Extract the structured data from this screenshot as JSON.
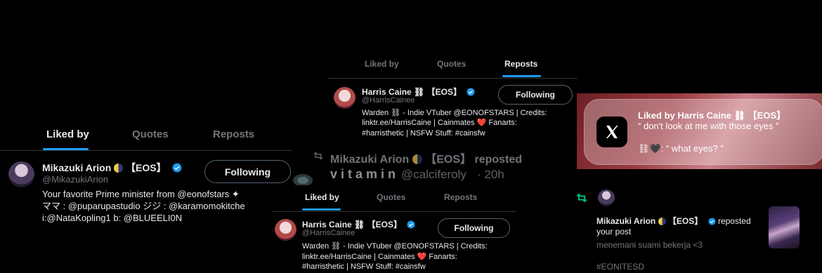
{
  "panel1": {
    "tabs": [
      "Liked by",
      "Quotes",
      "Reposts"
    ],
    "user": {
      "name": "Mikazuki Arion",
      "tag": "【EOS】",
      "handle": "@MikazukiArion",
      "button": "Following",
      "bio_lines": [
        "Your favorite Prime minister from @eonofstars ✦",
        "ママ : @puparupastudio ジジ : @karamomokitche",
        "i:@NataKopling1 b: @BLUEELI0N"
      ]
    }
  },
  "panel2": {
    "tabs": [
      "Liked by",
      "Quotes",
      "Reposts"
    ],
    "user": {
      "name": "Harris Caine ⛓",
      "tag": "【EOS】",
      "handle": "@HarrisCainee",
      "button": "Following",
      "bio_lines": [
        "Warden ⛓ - Indie VTuber @EONOFSTARS | Credits:",
        "linktr.ee/HarrisCaine | Cainmates ❤️ Fanarts:",
        "#harristhetic | NSFW Stuff: #cainsfw"
      ]
    }
  },
  "repost_row": {
    "text": "Mikazuki Arion",
    "tag": "【EOS】",
    "suffix": "reposted",
    "vitamin": "v i t a m i n",
    "handle": "@calciferoly",
    "time": "· 20h"
  },
  "panel3": {
    "tabs": [
      "Liked by",
      "Quotes",
      "Reposts"
    ],
    "user": {
      "name": "Harris Caine ⛓",
      "tag": "【EOS】",
      "handle": "@HarrisCainee",
      "button": "Following",
      "bio_lines": [
        "Warden ⛓ - Indie VTuber @EONOFSTARS | Credits:",
        "linktr.ee/HarrisCaine | Cainmates ❤️ Fanarts:",
        "#harristhetic | NSFW Stuff: #cainsfw"
      ]
    }
  },
  "notification": {
    "app_icon": "x-logo-icon",
    "title": "Liked by Harris Caine ⛓ 【EOS】",
    "line1": "“ don't look at me with those eyes ”",
    "line2": "⛓🖤: “ what eyes? ”"
  },
  "repost_notice": {
    "name": "Mikazuki Arion",
    "tag": "【EOS】",
    "action": "reposted",
    "line2": "your post",
    "post_text": "menemani suami bekerja <3",
    "hashtag": "#EONITESD"
  },
  "colors": {
    "accent": "#1d9bf0",
    "repost_green": "#00ba7c",
    "muted": "#71767b",
    "heart": "#f91880"
  }
}
